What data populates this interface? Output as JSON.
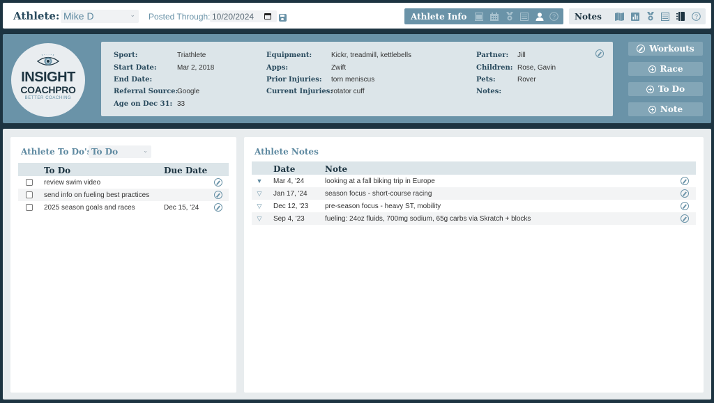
{
  "topbar": {
    "athlete_label": "Athlete:",
    "athlete_selected": "Mike D",
    "posted_through_label": "Posted Through:",
    "posted_through_value": "10/20/2024",
    "athlete_info_group": {
      "title": "Athlete Info",
      "icons": [
        "window-icon",
        "calendar-icon",
        "medal-icon",
        "table-icon",
        "person-icon",
        "help-icon"
      ]
    },
    "notes_group": {
      "title": "Notes",
      "icons": [
        "map-icon",
        "bar-chart-icon",
        "medal-icon",
        "table-icon",
        "notebook-icon",
        "help-icon"
      ]
    }
  },
  "logo": {
    "line1": "INSIGHT",
    "line2": "COACHPRO",
    "tagline": "BETTER COACHING"
  },
  "athlete_info": {
    "col1": [
      {
        "label": "Sport:",
        "value": "Triathlete"
      },
      {
        "label": "Start Date:",
        "value": "Mar 2, 2018"
      },
      {
        "label": "End Date:",
        "value": ""
      },
      {
        "label": "Referral Source:",
        "value": "Google"
      },
      {
        "label": "Age on Dec 31:",
        "value": "33"
      }
    ],
    "col2": [
      {
        "label": "Equipment:",
        "value": "Kickr, treadmill, kettlebells"
      },
      {
        "label": "Apps:",
        "value": "Zwift"
      },
      {
        "label": "Prior Injuries:",
        "value": "torn meniscus"
      },
      {
        "label": "Current Injuries:",
        "value": "rotator cuff"
      }
    ],
    "col3": [
      {
        "label": "Partner:",
        "value": "Jill"
      },
      {
        "label": "Children:",
        "value": "Rose, Gavin"
      },
      {
        "label": "Pets:",
        "value": "Rover"
      },
      {
        "label": "Notes:",
        "value": ""
      }
    ]
  },
  "actions": {
    "workouts": "Workouts",
    "race": "Race",
    "todo": "To Do",
    "note": "Note"
  },
  "todos": {
    "title": "Athlete To Do's:",
    "filter_selected": "To Do",
    "columns": [
      "To Do",
      "Due Date"
    ],
    "rows": [
      {
        "text": "review swim video",
        "due": "",
        "checked": false
      },
      {
        "text": "send info on fueling best practices",
        "due": "",
        "checked": false
      },
      {
        "text": "2025 season goals and races",
        "due": "Dec 15, '24",
        "checked": false
      }
    ]
  },
  "notes": {
    "title": "Athlete Notes",
    "columns": [
      "Date",
      "Note"
    ],
    "rows": [
      {
        "date": "Mar 4, '24",
        "note": "looking at a fall biking trip in Europe",
        "pinned": true
      },
      {
        "date": "Jan 17, '24",
        "note": "season focus - short-course racing",
        "pinned": false
      },
      {
        "date": "Dec 12, '23",
        "note": "pre-season focus - heavy ST, mobility",
        "pinned": false
      },
      {
        "date": "Sep 4, '23",
        "note": "fueling: 24oz fluids, 700mg sodium, 65g carbs via Skratch + blocks",
        "pinned": false
      }
    ]
  },
  "colors": {
    "navy": "#1d3441",
    "steel_blue": "#6a93a8",
    "light_panel": "#dce5e9",
    "page_bg": "#e8ecee"
  }
}
